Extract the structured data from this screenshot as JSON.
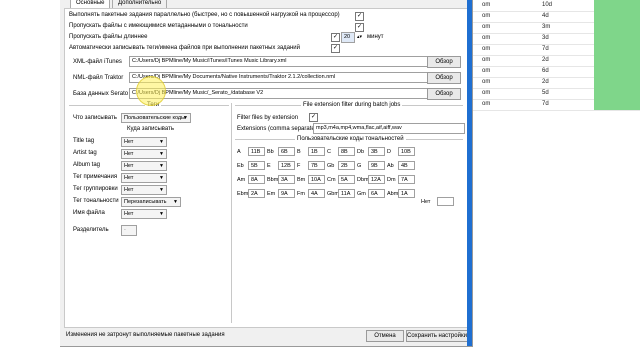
{
  "background_list": {
    "rows": [
      {
        "c1": "om",
        "c2": "10d"
      },
      {
        "c1": "om",
        "c2": "4d"
      },
      {
        "c1": "om",
        "c2": "3m"
      },
      {
        "c1": "om",
        "c2": "3d"
      },
      {
        "c1": "om",
        "c2": "7d"
      },
      {
        "c1": "om",
        "c2": "2d"
      },
      {
        "c1": "om",
        "c2": "6d"
      },
      {
        "c1": "om",
        "c2": "2d"
      },
      {
        "c1": "om",
        "c2": "5d"
      },
      {
        "c1": "om",
        "c2": "7d"
      }
    ],
    "accent": "#7fd68a"
  },
  "tabs": [
    "Основные",
    "Дополнительно"
  ],
  "options": {
    "parallel": "Выполнять пакетные задания параллельно (быстрее, но с повышенной нагрузкой на процессор)",
    "skip_tonality": "Пропускать файлы с имеющимися метаданными о тональности",
    "skip_longer": "Пропускать файлы длиннее",
    "skip_minutes": "20",
    "minutes_label": "минут",
    "auto_write": "Автоматически записывать теги/имена файлов при выполнении пакетных заданий"
  },
  "paths": {
    "itunes_label": "XML-файл iTunes",
    "itunes_value": "C:/Users/Dj BPMline/My Music/iTunes/iTunes Music Library.xml",
    "traktor_label": "NML-файл Traktor",
    "traktor_value": "C:/Users/Dj BPMline/My Documents/Native Instruments/Traktor 2.1.2/collection.nml",
    "serato_label": "База данных Serato",
    "serato_value": "C:/Users/Dj BPMline/My Music/_Serato_/database V2",
    "browse": "Обзор"
  },
  "tags": {
    "section": "Теги",
    "what_label": "Что записывать",
    "what_value": "Пользовательские коды",
    "where_label": "Куда записывать",
    "rows": [
      {
        "label": "Title tag",
        "value": "Нет"
      },
      {
        "label": "Artist tag",
        "value": "Нет"
      },
      {
        "label": "Album tag",
        "value": "Нет"
      },
      {
        "label": "Тег примечания",
        "value": "Нет"
      },
      {
        "label": "Тег группировки",
        "value": "Нет"
      },
      {
        "label": "Тег тональности",
        "value": "Перезаписывать"
      },
      {
        "label": "Имя файла",
        "value": "Нет"
      }
    ],
    "separator_label": "Разделитель",
    "separator_value": "-"
  },
  "filter": {
    "section": "File extension filter during batch jobs",
    "by_ext": "Filter files by extension",
    "ext_label": "Extensions (comma separated)",
    "ext_value": "mp3,m4a,mp4,wma,flac,aif,aiff,wav"
  },
  "keys": {
    "section": "Пользовательские коды тональностей",
    "rows": [
      [
        [
          "A",
          "11B"
        ],
        [
          "Bb",
          "6B"
        ],
        [
          "B",
          "1B"
        ],
        [
          "C",
          "8B"
        ],
        [
          "Db",
          "3B"
        ],
        [
          "D",
          "10B"
        ]
      ],
      [
        [
          "Eb",
          "5B"
        ],
        [
          "E",
          "12B"
        ],
        [
          "F",
          "7B"
        ],
        [
          "Gb",
          "2B"
        ],
        [
          "G",
          "9B"
        ],
        [
          "Ab",
          "4B"
        ]
      ],
      [
        [
          "Am",
          "8A"
        ],
        [
          "Bbm",
          "3A"
        ],
        [
          "Bm",
          "10A"
        ],
        [
          "Cm",
          "5A"
        ],
        [
          "Dbm",
          "12A"
        ],
        [
          "Dm",
          "7A"
        ]
      ],
      [
        [
          "Ebm",
          "2A"
        ],
        [
          "Em",
          "9A"
        ],
        [
          "Fm",
          "4A"
        ],
        [
          "Gbm",
          "11A"
        ],
        [
          "Gm",
          "6A"
        ],
        [
          "Abm",
          "1A"
        ]
      ]
    ],
    "none_label": "Нет",
    "none_value": ""
  },
  "footer": {
    "status": "Изменения не затронут выполняемые пакетные задания",
    "cancel": "Отмена",
    "save": "Сохранить настройки"
  }
}
